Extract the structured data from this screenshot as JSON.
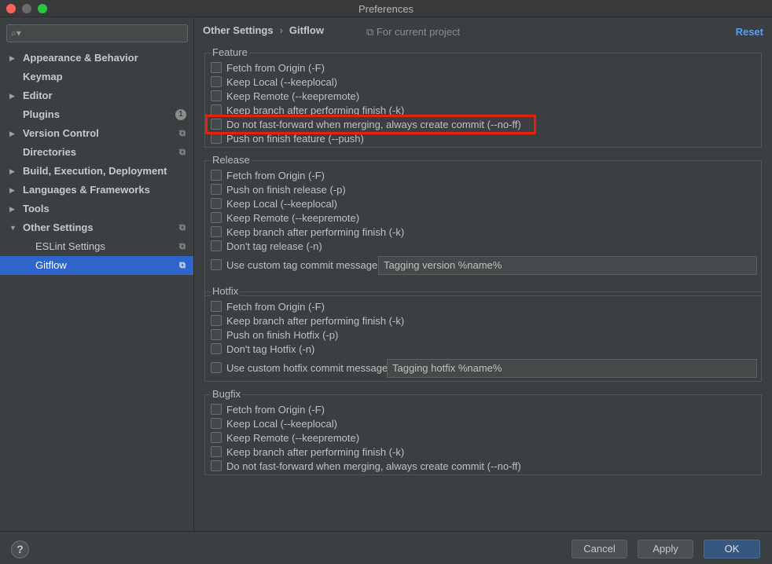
{
  "window": {
    "title": "Preferences"
  },
  "sidebar": {
    "search": {
      "placeholder": "",
      "icon": "search-icon"
    },
    "items": [
      {
        "label": "Appearance & Behavior",
        "arrow": "▶"
      },
      {
        "label": "Keymap"
      },
      {
        "label": "Editor",
        "arrow": "▶"
      },
      {
        "label": "Plugins",
        "badge": "1"
      },
      {
        "label": "Version Control",
        "arrow": "▶",
        "copy": "⧉"
      },
      {
        "label": "Directories",
        "copy": "⧉"
      },
      {
        "label": "Build, Execution, Deployment",
        "arrow": "▶"
      },
      {
        "label": "Languages & Frameworks",
        "arrow": "▶"
      },
      {
        "label": "Tools",
        "arrow": "▶"
      },
      {
        "label": "Other Settings",
        "arrow": "▼",
        "copy": "⧉"
      },
      {
        "label": "ESLint Settings",
        "copy": "⧉"
      },
      {
        "label": "Gitflow",
        "copy": "⧉"
      }
    ]
  },
  "header": {
    "breadcrumb_parent": "Other Settings",
    "breadcrumb_sep": "›",
    "breadcrumb_current": "Gitflow",
    "scope_icon": "⧉",
    "scope": "For current project",
    "reset": "Reset"
  },
  "feature": {
    "title": "Feature",
    "options": [
      "Fetch from Origin (-F)",
      "Keep Local (--keeplocal)",
      "Keep Remote (--keepremote)",
      "Keep branch after performing finish (-k)",
      "Do not fast-forward when merging, always create commit (--no-ff)",
      "Push on finish feature (--push)"
    ]
  },
  "release": {
    "title": "Release",
    "options": [
      "Fetch from Origin (-F)",
      "Push on finish release (-p)",
      "Keep Local (--keeplocal)",
      "Keep Remote (--keepremote)",
      "Keep branch after performing finish (-k)",
      "Don't tag release (-n)",
      "Use custom tag commit message"
    ],
    "custom_message_value": "Tagging version %name%"
  },
  "hotfix": {
    "title": "Hotfix",
    "options": [
      "Fetch from Origin (-F)",
      "Keep branch after performing finish (-k)",
      "Push on finish Hotfix (-p)",
      "Don't tag Hotfix (-n)",
      "Use custom hotfix commit message"
    ],
    "custom_message_value": "Tagging hotfix %name%"
  },
  "bugfix": {
    "title": "Bugfix",
    "options": [
      "Fetch from Origin (-F)",
      "Keep Local (--keeplocal)",
      "Keep Remote (--keepremote)",
      "Keep branch after performing finish (-k)",
      "Do not fast-forward when merging, always create commit (--no-ff)"
    ]
  },
  "footer": {
    "help": "?",
    "cancel": "Cancel",
    "apply": "Apply",
    "ok": "OK"
  },
  "colors": {
    "background": "#3c3f41",
    "selection": "#2f65ca",
    "link": "#589df6",
    "highlight": "#e5210b",
    "primary_button": "#365880"
  }
}
